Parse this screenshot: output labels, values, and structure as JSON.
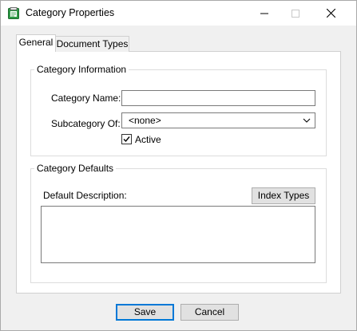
{
  "window": {
    "title": "Category Properties"
  },
  "tabs": [
    {
      "label": "General",
      "active": true
    },
    {
      "label": "Document Types",
      "active": false
    }
  ],
  "category_information": {
    "legend": "Category Information",
    "name_label": "Category Name:",
    "name_value": "",
    "subcategory_label": "Subcategory Of:",
    "subcategory_value": "<none>",
    "active_label": "Active",
    "active_checked": true
  },
  "category_defaults": {
    "legend": "Category Defaults",
    "description_label": "Default Description:",
    "description_value": "",
    "index_types_label": "Index Types"
  },
  "footer": {
    "save_label": "Save",
    "cancel_label": "Cancel"
  },
  "colors": {
    "accent": "#0078d7",
    "icon_green": "#2e9a46"
  }
}
